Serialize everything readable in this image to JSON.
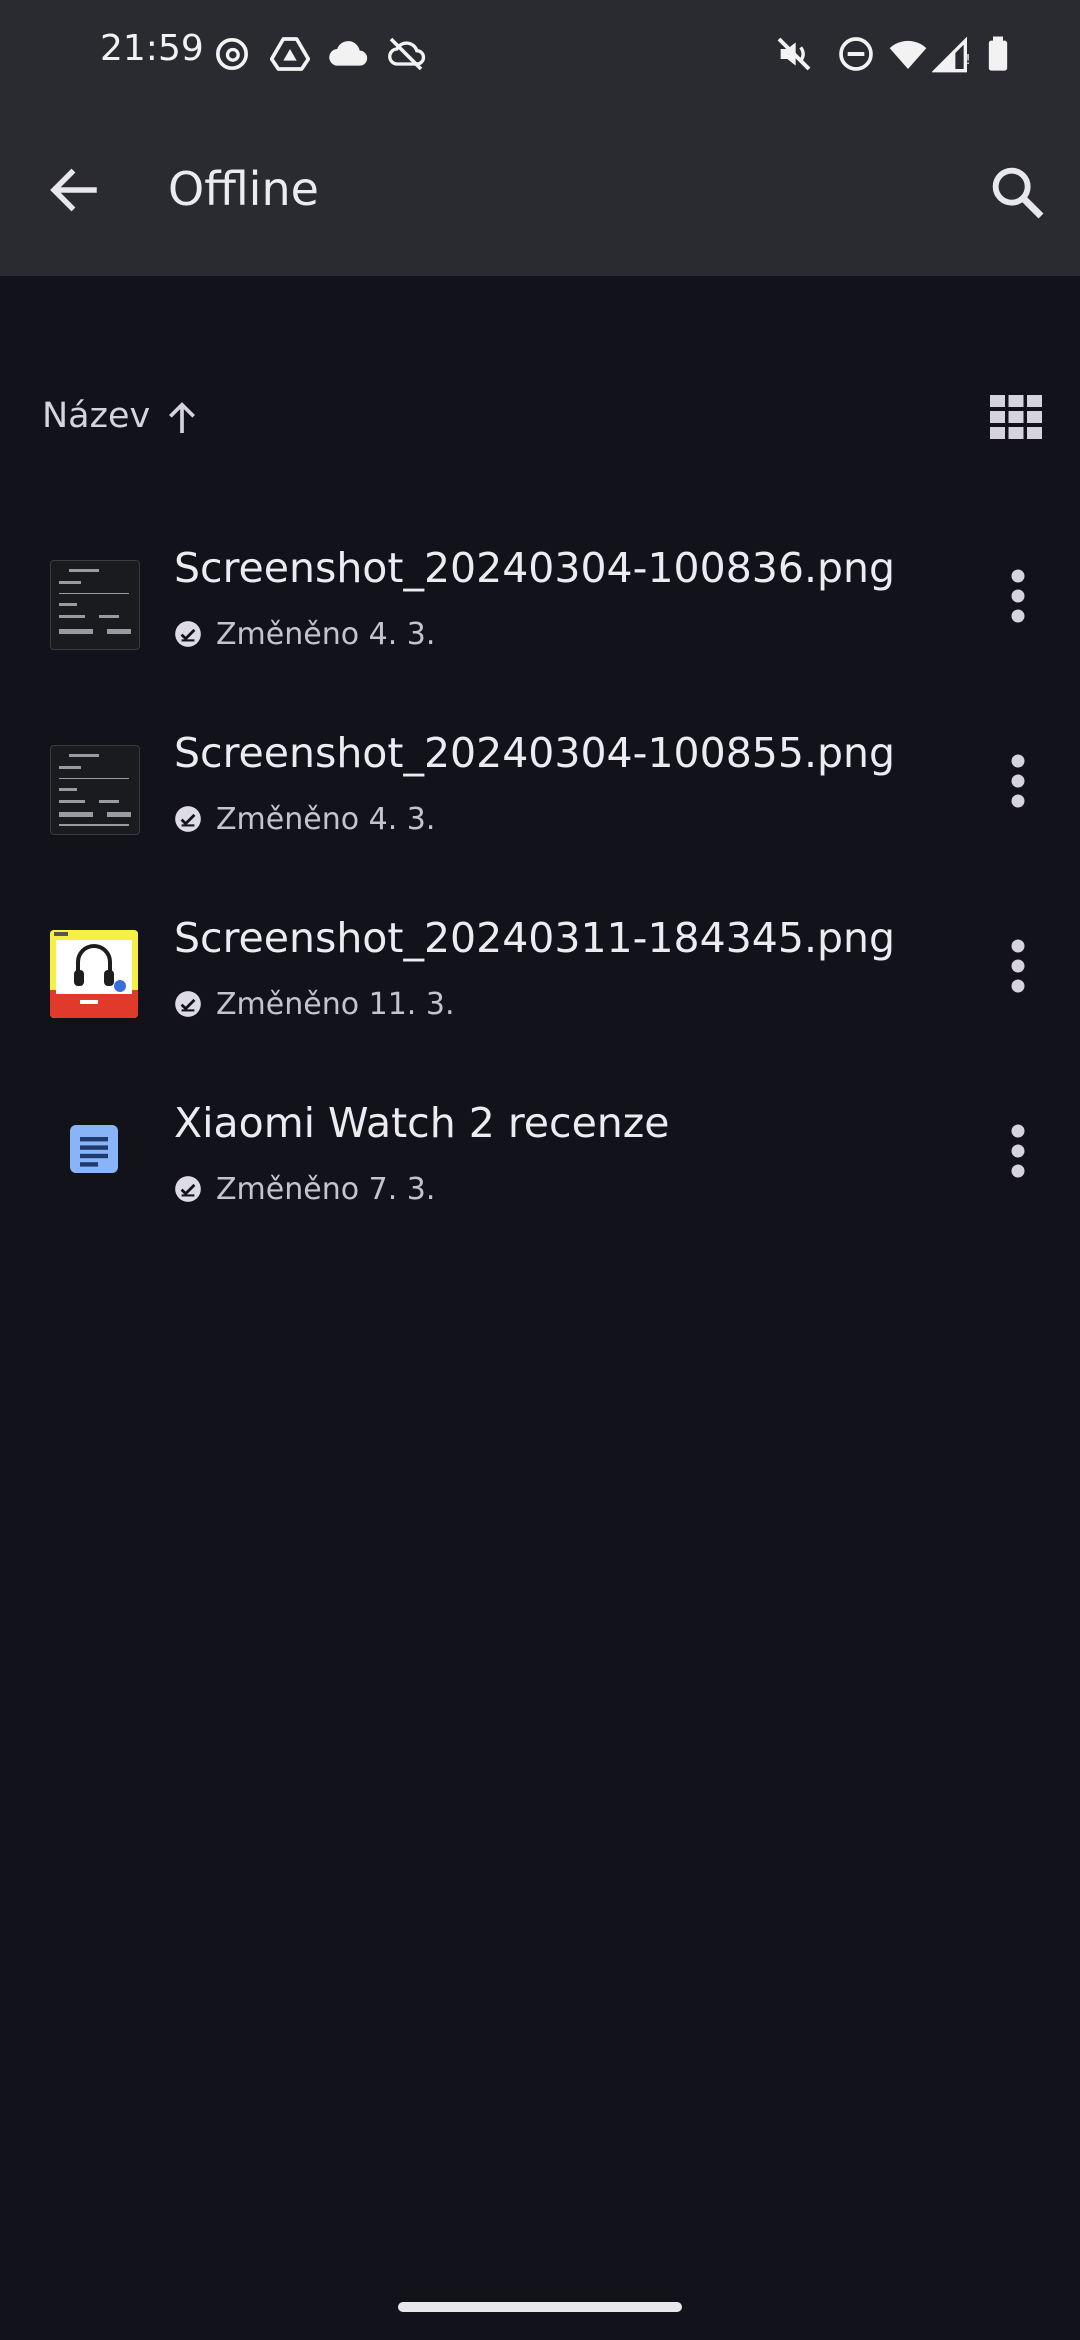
{
  "status_bar": {
    "time": "21:59",
    "left_icons": [
      "threads-icon",
      "drive-icon",
      "cloud-icon",
      "cloud-off-icon"
    ],
    "right_icons": [
      "mute-icon",
      "dnd-icon",
      "wifi-icon",
      "signal-icon",
      "battery-icon"
    ]
  },
  "app_bar": {
    "title": "Offline"
  },
  "sort": {
    "label": "Název",
    "direction": "ascending"
  },
  "files": [
    {
      "name": "Screenshot_20240304-100836.png",
      "modified": "Změněno 4. 3.",
      "thumb": "dark-screenshot"
    },
    {
      "name": "Screenshot_20240304-100855.png",
      "modified": "Změněno 4. 3.",
      "thumb": "dark-screenshot"
    },
    {
      "name": "Screenshot_20240311-184345.png",
      "modified": "Změněno 11. 3.",
      "thumb": "headphones-screenshot"
    },
    {
      "name": "Xiaomi Watch 2 recenze",
      "modified": "Změněno 7. 3.",
      "thumb": "docs-icon"
    }
  ],
  "colors": {
    "background": "#12131a",
    "top_bar": "#2a2b30",
    "docs_blue": "#8ab4f8"
  }
}
